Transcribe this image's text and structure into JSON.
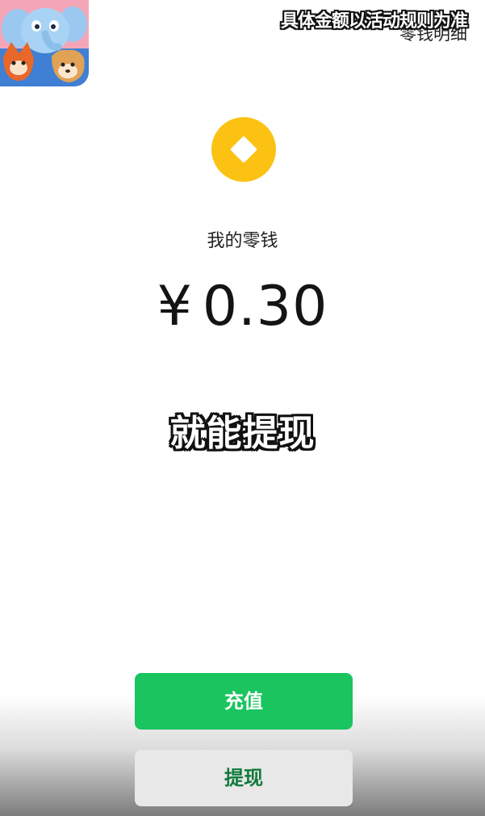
{
  "overlay": {
    "caption_top": "具体金额以活动规则为准",
    "caption_mid": "就能提现"
  },
  "header": {
    "details_link": "零钱明细",
    "logo_icon": "cartoon-elephant-app-logo"
  },
  "wallet": {
    "coin_icon": "coin-diamond-icon",
    "label": "我的零钱",
    "currency_symbol": "¥",
    "amount": "0.30"
  },
  "actions": {
    "recharge_label": "充值",
    "withdraw_label": "提现"
  },
  "colors": {
    "accent_green": "#1ac45f",
    "withdraw_text": "#137a3c",
    "coin_yellow": "#fbc214"
  }
}
